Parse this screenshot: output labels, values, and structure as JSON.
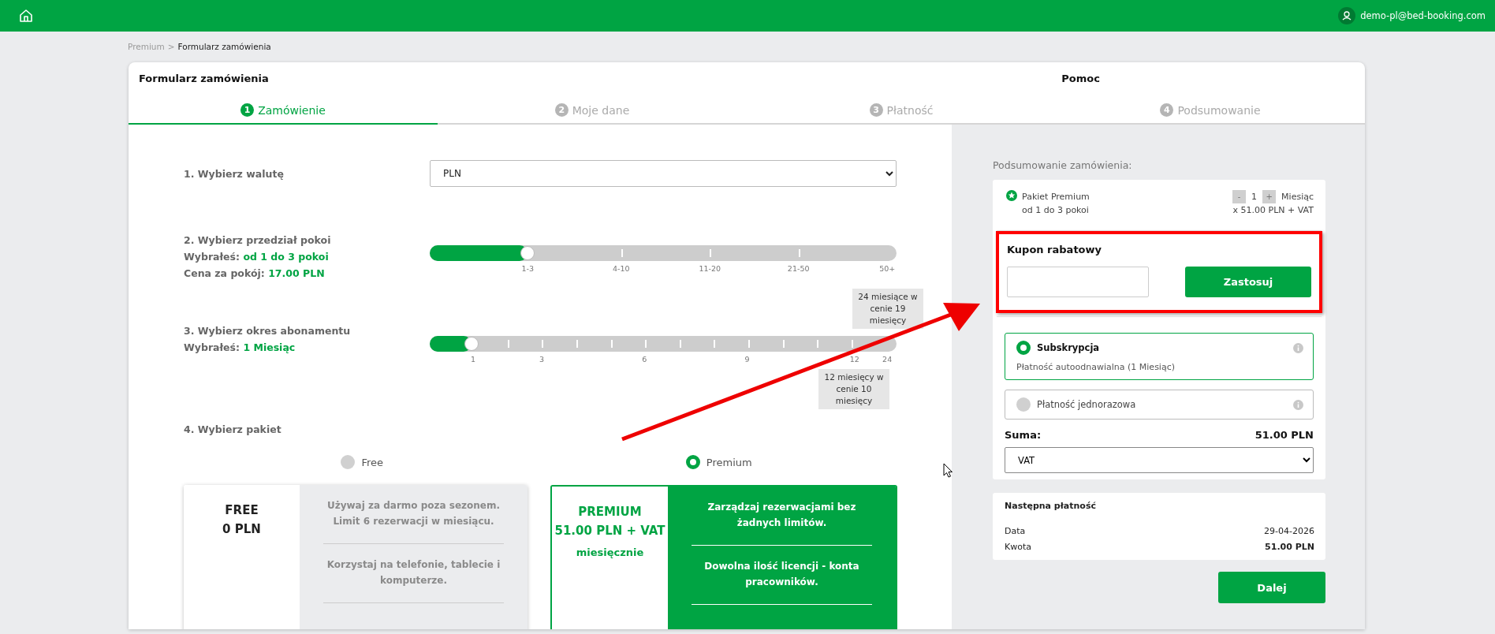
{
  "topbar": {
    "user_email": "demo-pl@bed-booking.com"
  },
  "breadcrumb": {
    "items": [
      "Premium",
      "Formularz zamówienia"
    ],
    "separator": ">"
  },
  "form": {
    "title": "Formularz zamówienia",
    "help": "Pomoc"
  },
  "steps": [
    {
      "number": "1",
      "label": "Zamówienie",
      "selected": true
    },
    {
      "number": "2",
      "label": "Moje dane",
      "selected": false
    },
    {
      "number": "3",
      "label": "Płatność",
      "selected": false
    },
    {
      "number": "4",
      "label": "Podsumowanie",
      "selected": false
    }
  ],
  "currency": {
    "label": "1. Wybierz walutę",
    "value": "PLN"
  },
  "rooms": {
    "label": "2. Wybierz przedział pokoi",
    "chosen_label": "Wybrałeś:",
    "chosen_value": "od 1 do 3 pokoi",
    "price_label": "Cena za pokój:",
    "price_value": "17.00 PLN",
    "level": 0.21,
    "ticks": [
      "1-3",
      "4-10",
      "11-20",
      "21-50",
      "50+"
    ]
  },
  "period": {
    "label": "3. Wybierz okres abonamentu",
    "chosen_label": "Wybrałeś:",
    "chosen_value": "1 Miesiąc",
    "level": 0.09,
    "ticks": [
      "1",
      "3",
      "6",
      "9",
      "12",
      "24"
    ],
    "notes": [
      "24 miesiące w cenie 19 miesięcy",
      "12 miesięcy w cenie 10 miesięcy"
    ]
  },
  "package": {
    "label": "4. Wybierz pakiet",
    "options": [
      {
        "label": "Free",
        "selected": false
      },
      {
        "label": "Premium",
        "selected": true
      }
    ],
    "cards": [
      {
        "name": "FREE",
        "price": "0 PLN",
        "selected": false,
        "features": [
          "Używaj za darmo poza sezonem. Limit 6 rezerwacji w miesiącu.",
          "Korzystaj na telefonie, tablecie i komputerze."
        ]
      },
      {
        "name": "PREMIUM",
        "price": "51.00 PLN + VAT",
        "period": "miesięcznie",
        "selected": true,
        "features": [
          "Zarządzaj rezerwacjami bez żadnych limitów.",
          "Dowolna ilość licencji - konta pracowników."
        ]
      }
    ]
  },
  "summary": {
    "title": "Podsumowanie zamówienia:",
    "item": {
      "name": "Pakiet Premium",
      "rooms": "od 1 do 3 pokoi",
      "minus": "-",
      "quantity": "1",
      "plus": "+",
      "unit": "Miesiąc",
      "price": "x 51.00 PLN + VAT"
    },
    "coupon": {
      "title": "Kupon rabatowy",
      "button": "Zastosuj",
      "highlighted": true
    },
    "payment_options": [
      {
        "title": "Subskrypcja",
        "description": "Płatność autoodnawialna (1 Miesiąc)",
        "selected": true
      },
      {
        "title": "Płatność jednorazowa",
        "selected": false
      }
    ],
    "total_label": "Suma:",
    "total_value": "51.00 PLN",
    "tax": "VAT"
  },
  "next_payment": {
    "title": "Następna płatność",
    "rows": [
      {
        "label": "Data",
        "value": "29-04-2026"
      },
      {
        "label": "Kwota",
        "value": "51.00 PLN"
      }
    ]
  },
  "next_button": "Dalej"
}
